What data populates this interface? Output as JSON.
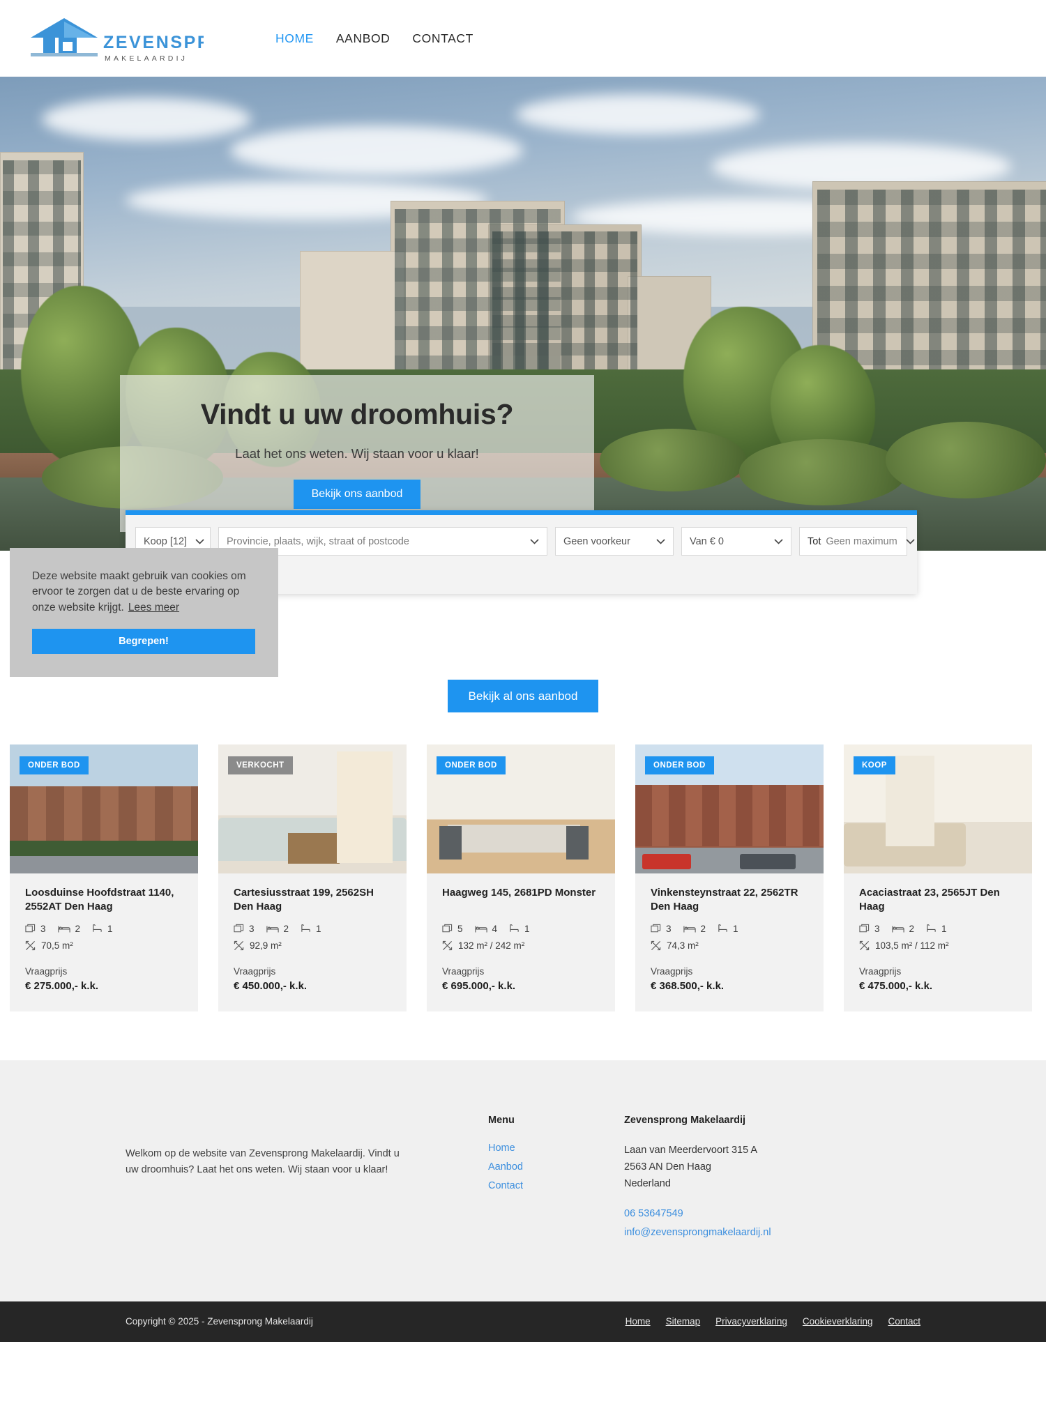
{
  "brand": {
    "name": "ZEVENSPRONG",
    "tagline": "M A K E L A A R D I J",
    "accent_color": "#1e94f0"
  },
  "nav": {
    "items": [
      {
        "label": "HOME",
        "active": true
      },
      {
        "label": "AANBOD",
        "active": false
      },
      {
        "label": "CONTACT",
        "active": false
      }
    ]
  },
  "hero": {
    "title": "Vindt u uw droomhuis?",
    "subtitle": "Laat het ons weten. Wij staan voor u klaar!",
    "cta_label": "Bekijk ons aanbod"
  },
  "search": {
    "type_value": "Koop [12]",
    "location_placeholder": "Provincie, plaats, wijk, straat of postcode",
    "category_value": "Geen voorkeur",
    "price_from_value": "Van € 0",
    "price_to_prefix": "Tot",
    "price_to_value": "Geen maximum"
  },
  "cookie": {
    "text": "Deze website maakt gebruik van cookies om ervoor te zorgen dat u de beste ervaring op onze website krijgt.",
    "link_label": "Lees meer",
    "accept_label": "Begrepen!"
  },
  "listings": {
    "cta_label": "Bekijk al ons aanbod",
    "price_label": "Vraagprijs",
    "items": [
      {
        "badge": "ONDER BOD",
        "badge_type": "onderbod",
        "title": "Loosduinse Hoofdstraat 1140, 2552AT Den Haag",
        "rooms": "3",
        "bedrooms": "2",
        "bathrooms": "1",
        "area": "70,5 m²",
        "price_label": "Vraagprijs",
        "price": "€ 275.000,- k.k."
      },
      {
        "badge": "VERKOCHT",
        "badge_type": "verkocht",
        "title": "Cartesiusstraat 199, 2562SH Den Haag",
        "rooms": "3",
        "bedrooms": "2",
        "bathrooms": "1",
        "area": "92,9 m²",
        "price_label": "Vraagprijs",
        "price": "€ 450.000,- k.k."
      },
      {
        "badge": "ONDER BOD",
        "badge_type": "onderbod",
        "title": "Haagweg 145, 2681PD Monster",
        "rooms": "5",
        "bedrooms": "4",
        "bathrooms": "1",
        "area": "132 m² / 242 m²",
        "price_label": "Vraagprijs",
        "price": "€ 695.000,- k.k."
      },
      {
        "badge": "ONDER BOD",
        "badge_type": "onderbod",
        "title": "Vinkensteynstraat 22, 2562TR Den Haag",
        "rooms": "3",
        "bedrooms": "2",
        "bathrooms": "1",
        "area": "74,3 m²",
        "price_label": "Vraagprijs",
        "price": "€ 368.500,- k.k."
      },
      {
        "badge": "KOOP",
        "badge_type": "koop",
        "title": "Acaciastraat 23, 2565JT Den Haag",
        "rooms": "3",
        "bedrooms": "2",
        "bathrooms": "1",
        "area": "103,5 m² / 112 m²",
        "price_label": "Vraagprijs",
        "price": "€ 475.000,- k.k."
      }
    ]
  },
  "footer": {
    "about_text": "Welkom op de website van Zevensprong Makelaardij. Vindt u uw droomhuis? Laat het ons weten. Wij staan voor u klaar!",
    "menu_heading": "Menu",
    "menu_links": [
      {
        "label": "Home"
      },
      {
        "label": "Aanbod"
      },
      {
        "label": "Contact"
      }
    ],
    "contact_heading": "Zevensprong Makelaardij",
    "address_line1": "Laan van Meerdervoort 315 A",
    "address_line2": "2563 AN Den Haag",
    "address_line3": "Nederland",
    "phone": "06 53647549",
    "email": "info@zevensprongmakelaardij.nl"
  },
  "bottombar": {
    "copyright": "Copyright © 2025 - Zevensprong Makelaardij",
    "links": [
      {
        "label": "Home"
      },
      {
        "label": "Sitemap"
      },
      {
        "label": "Privacyverklaring"
      },
      {
        "label": "Cookieverklaring"
      },
      {
        "label": "Contact"
      }
    ]
  }
}
